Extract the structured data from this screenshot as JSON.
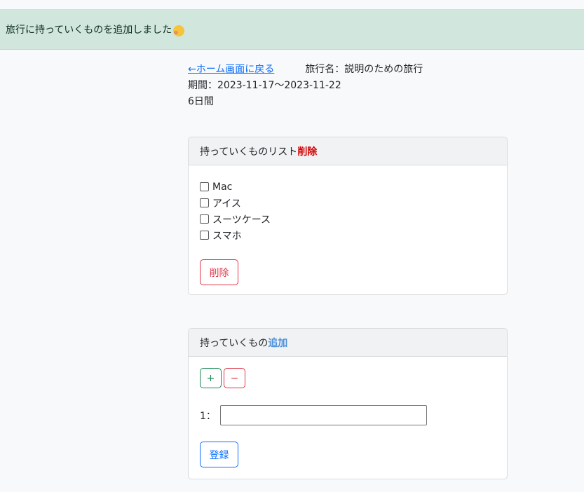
{
  "alert": {
    "message": "旅行に持っていくものを追加しました",
    "emoji": "hugging-face-emoji"
  },
  "trip": {
    "back_link": "←ホーム画面に戻る",
    "name": "旅行名：説明のための旅行",
    "period": "期間：2023-11-17〜2023-11-22",
    "days": "6日間"
  },
  "list_card": {
    "title": "持っていくものリスト",
    "title_action": "削除",
    "items": [
      {
        "label": "Mac",
        "checked": false
      },
      {
        "label": "アイス",
        "checked": false
      },
      {
        "label": "スーツケース",
        "checked": false
      },
      {
        "label": "スマホ",
        "checked": false
      }
    ],
    "delete_button": "削除"
  },
  "add_card": {
    "title": "持っていくもの",
    "title_action": "追加",
    "plus_button": "+",
    "minus_button": "−",
    "field_label": "1：",
    "field_value": "",
    "register_button": "登録"
  },
  "colors": {
    "alert_bg": "#d1e7dd",
    "danger": "#dc3545",
    "success": "#198754",
    "primary": "#0d6efd"
  }
}
